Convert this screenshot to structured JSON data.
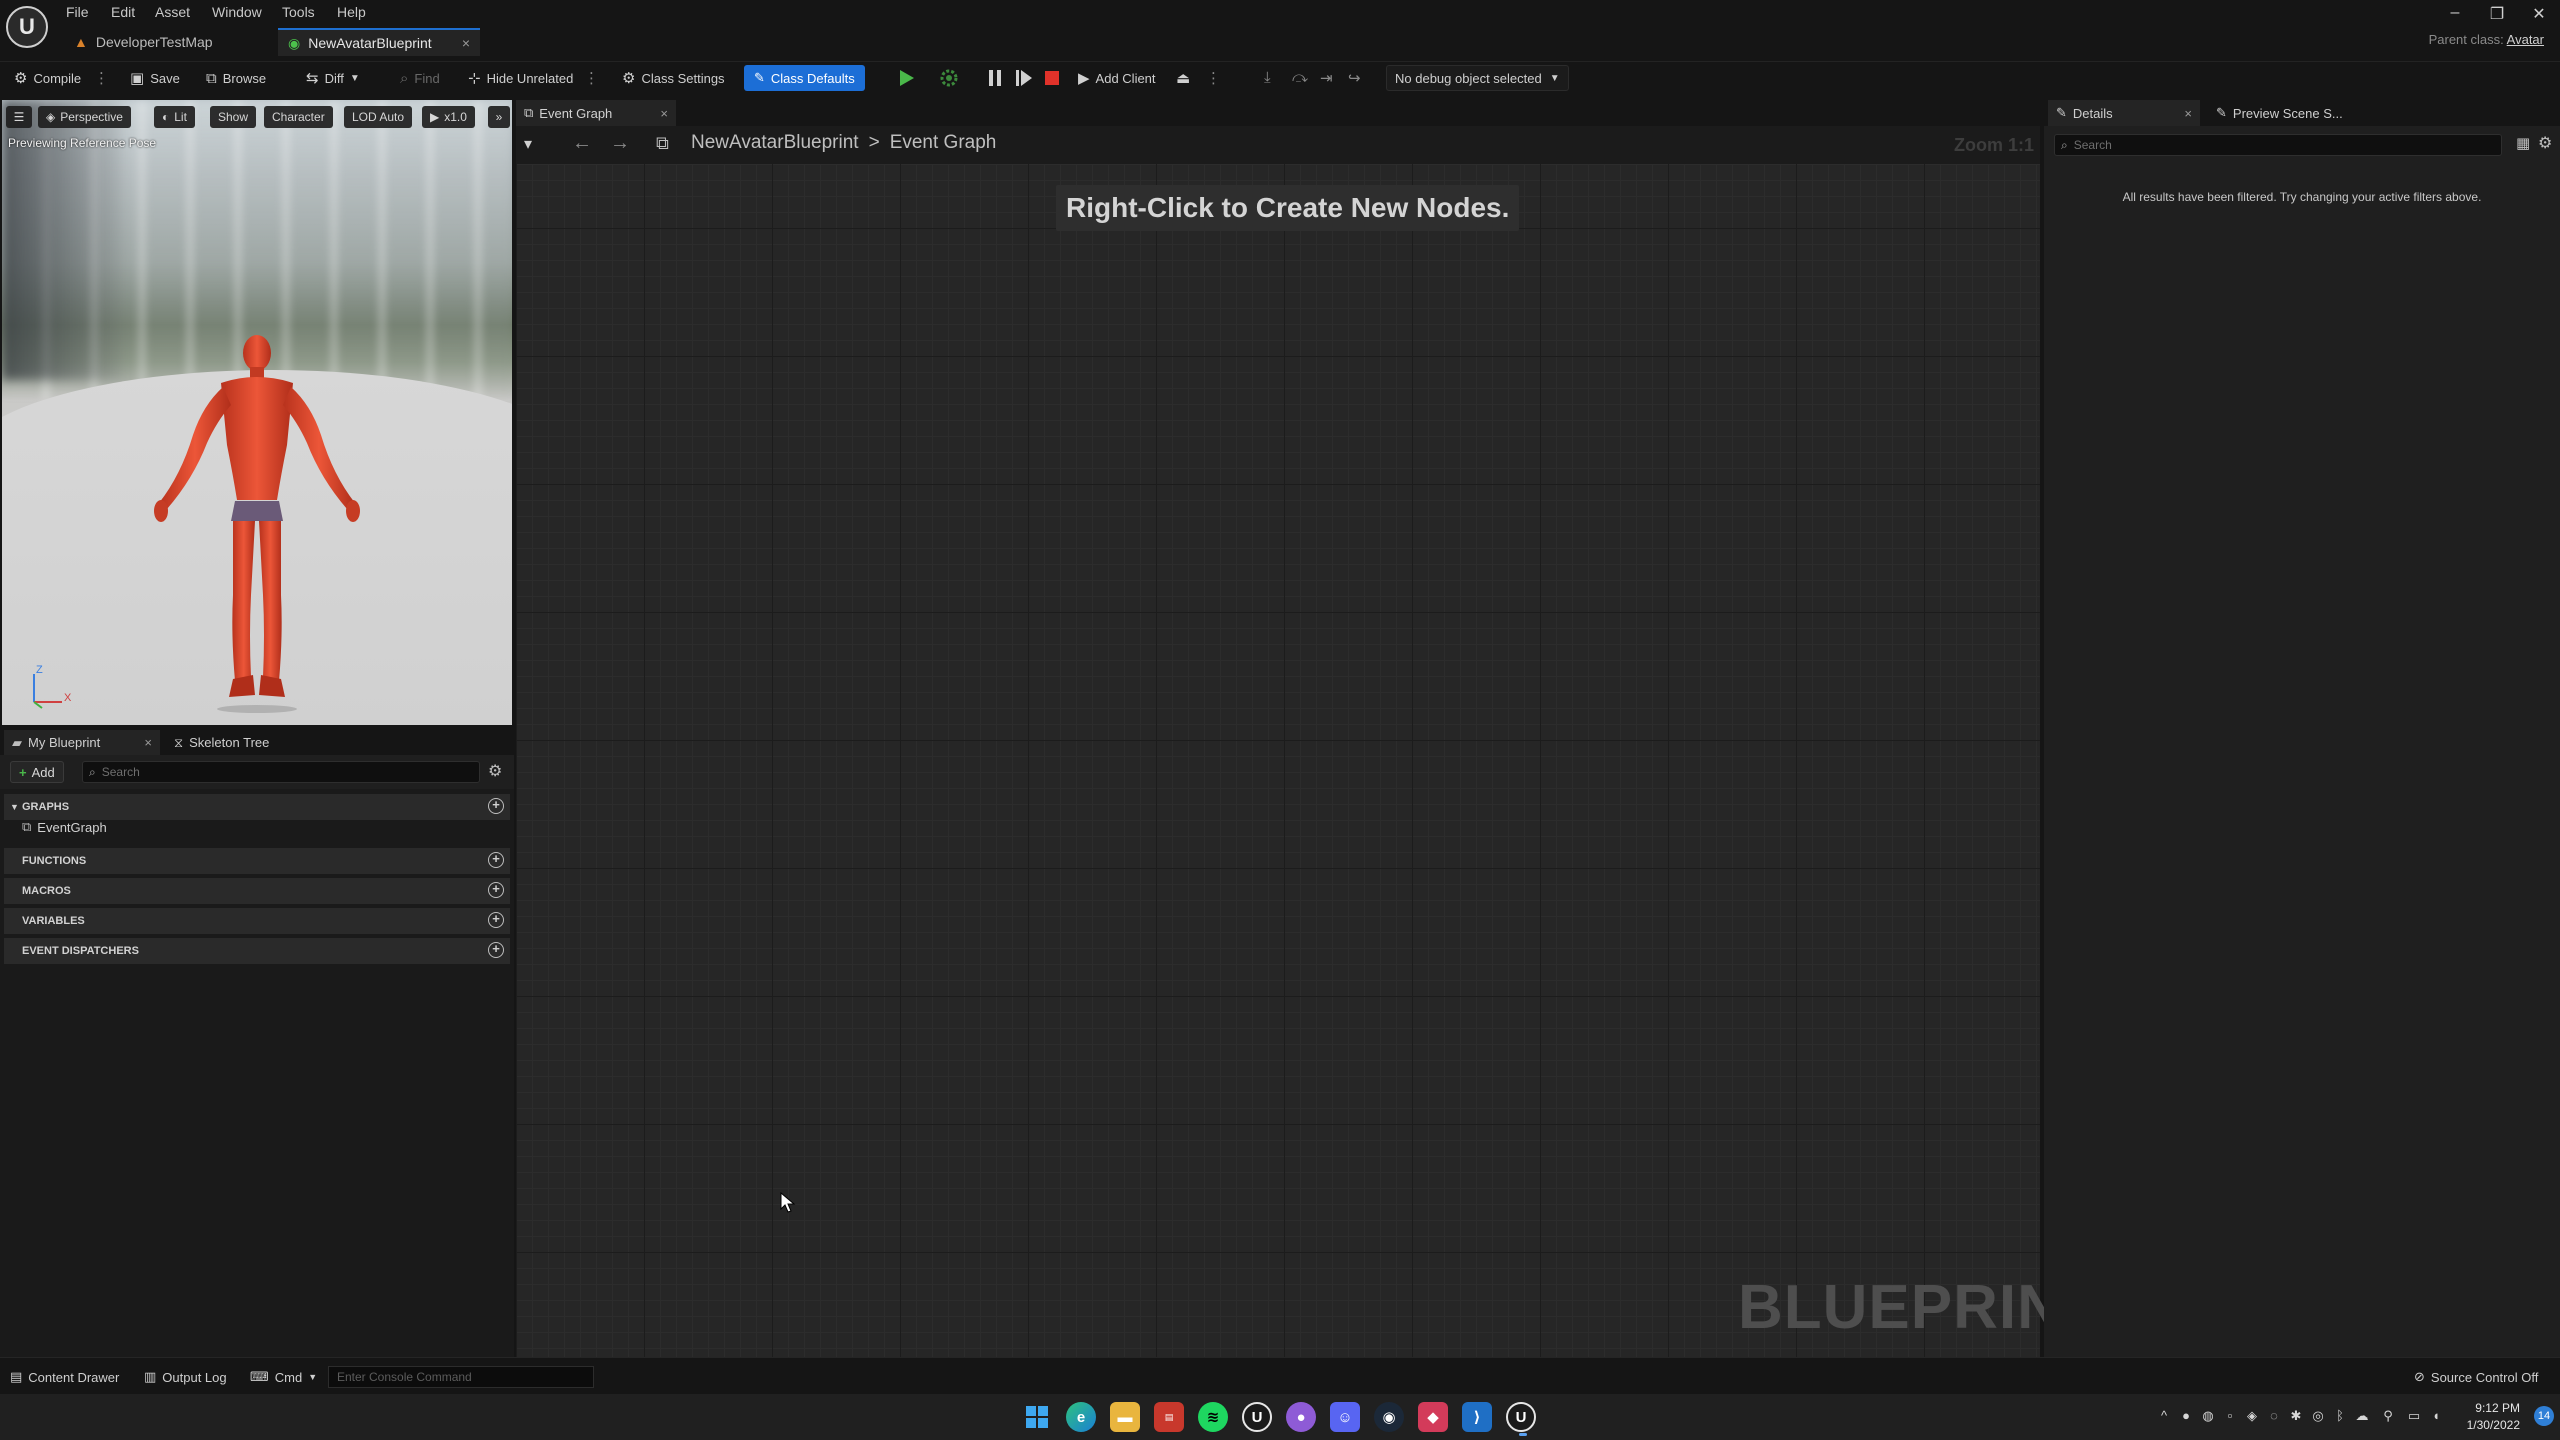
{
  "menu": [
    "File",
    "Edit",
    "Asset",
    "Window",
    "Tools",
    "Help"
  ],
  "doc_tabs": {
    "map": "DeveloperTestMap",
    "blueprint": "NewAvatarBlueprint",
    "close_symbol": "×"
  },
  "parent_class": {
    "label": "Parent class:",
    "value": "Avatar"
  },
  "window_controls": {
    "minimize": "–",
    "restore": "❐",
    "close": "✕"
  },
  "toolbar": {
    "compile": "Compile",
    "save": "Save",
    "browse": "Browse",
    "diff": "Diff",
    "find": "Find",
    "hide_unrelated": "Hide Unrelated",
    "class_settings": "Class Settings",
    "class_defaults": "Class Defaults",
    "add_client": "Add Client",
    "debug_object": "No debug object selected"
  },
  "viewport": {
    "buttons": [
      "Perspective",
      "Lit",
      "Show",
      "Character",
      "LOD Auto",
      "x1.0"
    ],
    "status": "Previewing Reference Pose",
    "axis_z": "Z",
    "axis_x": "X"
  },
  "my_blueprint": {
    "tab_label": "My Blueprint",
    "skeleton_tab": "Skeleton Tree",
    "add_label": "Add",
    "search_placeholder": "Search",
    "sections": {
      "graphs": "GRAPHS",
      "functions": "FUNCTIONS",
      "macros": "MACROS",
      "variables": "VARIABLES",
      "event_dispatchers": "EVENT DISPATCHERS"
    },
    "graph_item": "EventGraph"
  },
  "graph": {
    "tab_label": "Event Graph",
    "breadcrumb_root": "NewAvatarBlueprint",
    "breadcrumb_separator": ">",
    "breadcrumb_current": "Event Graph",
    "zoom": "Zoom 1:1",
    "hint": "Right-Click to Create New Nodes.",
    "watermark": "BLUEPRINT"
  },
  "details": {
    "tab_label": "Details",
    "preview_tab": "Preview Scene S...",
    "search_placeholder": "Search",
    "message": "All results have been filtered. Try changing your active filters above."
  },
  "statusbar": {
    "content_drawer": "Content Drawer",
    "output_log": "Output Log",
    "cmd": "Cmd",
    "console_placeholder": "Enter Console Command",
    "source_control": "Source Control Off"
  },
  "taskbar": {
    "time": "9:12 PM",
    "date": "1/30/2022",
    "notifications": "14"
  },
  "colors": {
    "accent_blue": "#1c6ed6",
    "avatar_red": "#e0452a",
    "play_green": "#4ab84a",
    "stop_red": "#e0322a"
  }
}
